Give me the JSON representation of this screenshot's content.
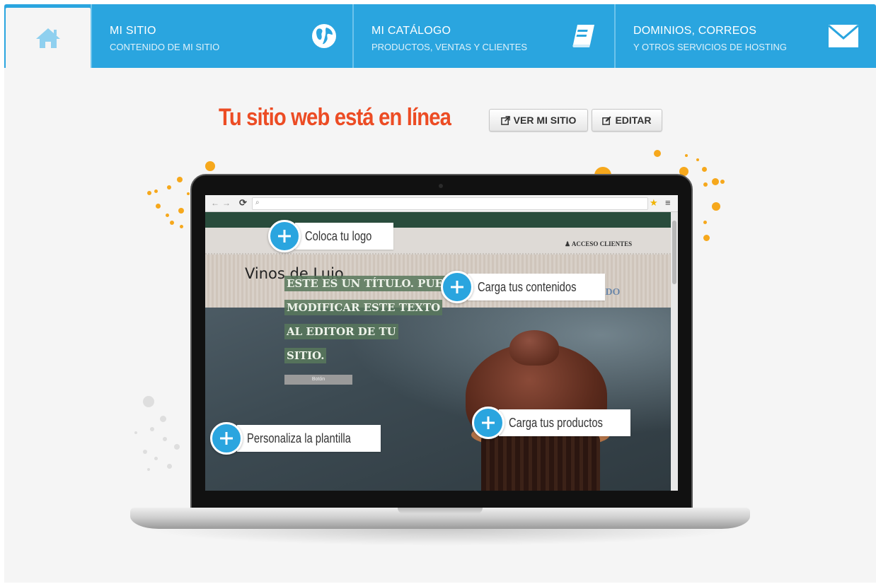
{
  "nav": {
    "items": [
      {
        "title": "MI SITIO",
        "subtitle": "CONTENIDO DE MI SITIO",
        "icon": "globe-icon"
      },
      {
        "title": "MI CATÁLOGO",
        "subtitle": "PRODUCTOS, VENTAS Y CLIENTES",
        "icon": "book-icon"
      },
      {
        "title": "DOMINIOS, CORREOS",
        "subtitle": "Y OTROS SERVICIOS DE HOSTING",
        "icon": "envelope-icon"
      }
    ],
    "home_icon": "home-icon",
    "bar_color": "#2aa5df"
  },
  "headline": {
    "text": "Tu sitio web está en línea",
    "color": "#ec4c24"
  },
  "buttons": {
    "view_site": "VER MI SITIO",
    "edit": "EDITAR"
  },
  "preview": {
    "site_title": "Vinos de Lujo",
    "acceso_clientes": "ACCESO CLIENTES",
    "ghost_text": "IDO",
    "hero_lines": [
      "ESTE ES UN TÍTULO. PUEDES",
      "MODIFICAR ESTE TEXTO",
      "AL EDITOR DE TU",
      "SITIO."
    ],
    "hero_button": "Botón"
  },
  "callouts": {
    "logo": "Coloca tu logo",
    "contenidos": "Carga tus contenidos",
    "productos": "Carga tus productos",
    "plantilla": "Personaliza la plantilla"
  }
}
